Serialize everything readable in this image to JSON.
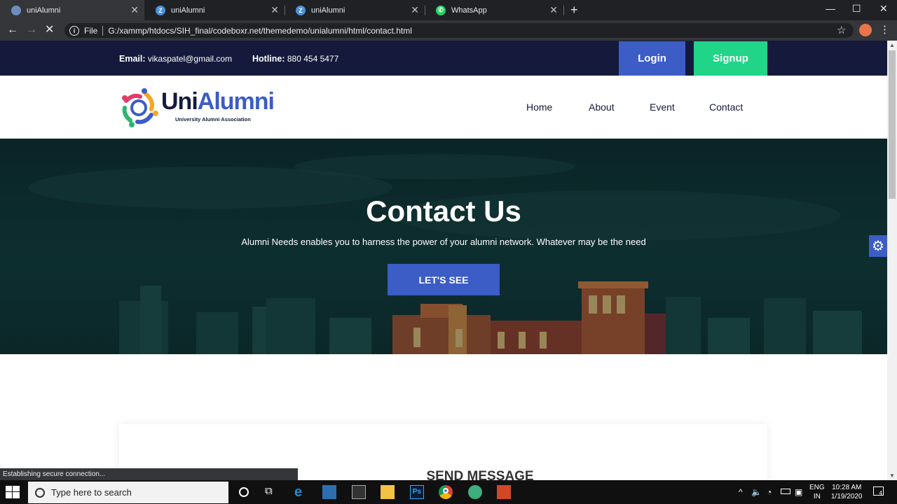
{
  "browser": {
    "tabs": [
      {
        "title": "uniAlumni",
        "active": true
      },
      {
        "title": "uniAlumni",
        "active": false
      },
      {
        "title": "uniAlumni",
        "active": false
      },
      {
        "title": "WhatsApp",
        "active": false
      }
    ],
    "new_tab": "+",
    "url_scheme_label": "File",
    "url": "G:/xammp/htdocs/SIH_final/codeboxr.net/themedemo/unialumni/html/contact.html",
    "status_text": "Establishing secure connection..."
  },
  "topbar": {
    "email_label": "Email:",
    "email_value": "vikaspatel@gmail.com",
    "hotline_label": "Hotline:",
    "hotline_value": "880 454 5477",
    "login_label": "Login",
    "signup_label": "Signup"
  },
  "logo": {
    "word_part1": "Uni",
    "word_part2": "Alumni",
    "subtitle": "University Alumni Association"
  },
  "nav": {
    "items": [
      "Home",
      "About",
      "Event",
      "Contact"
    ]
  },
  "hero": {
    "title": "Contact Us",
    "text": "Alumni Needs enables you to harness the power of your alumni network. Whatever may be the need",
    "button_label": "LET'S SEE"
  },
  "contact_form": {
    "heading": "SEND MESSAGE"
  },
  "taskbar": {
    "search_placeholder": "Type here to search",
    "lang_line1": "ENG",
    "lang_line2": "IN",
    "time": "10:28 AM",
    "date": "1/19/2020",
    "notification_count": "4"
  },
  "colors": {
    "brand_blue": "#3c5cc6",
    "brand_navy": "#151a3d",
    "signup_green": "#20d488"
  }
}
